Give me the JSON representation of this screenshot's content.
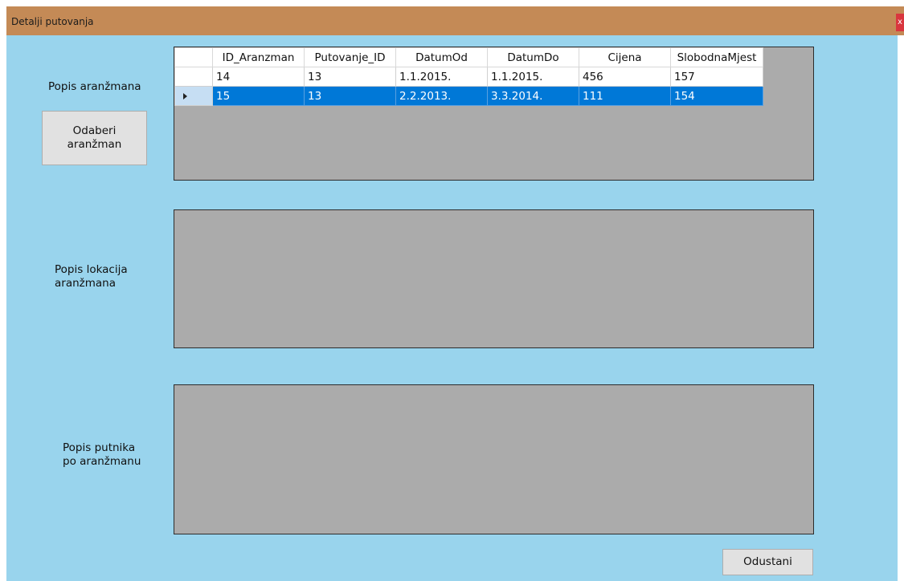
{
  "window": {
    "title": "Detalji putovanja",
    "close_glyph": "x"
  },
  "labels": {
    "arrangements": "Popis aranžmana",
    "locations": "Popis lokacija\naranžmana",
    "passengers": "Popis putnika\npo aranžmanu"
  },
  "buttons": {
    "select_arrangement": "Odaberi\naranžman",
    "cancel": "Odustani"
  },
  "arrangements_grid": {
    "columns": [
      "ID_Aranzman",
      "Putovanje_ID",
      "DatumOd",
      "DatumDo",
      "Cijena",
      "SlobodnaMjest"
    ],
    "rows": [
      {
        "cells": [
          "14",
          "13",
          "1.1.2015.",
          "1.1.2015.",
          "456",
          "157"
        ],
        "selected": false
      },
      {
        "cells": [
          "15",
          "13",
          "2.2.2013.",
          "3.3.2014.",
          "111",
          "154"
        ],
        "selected": true
      }
    ],
    "row_indicator_icon": "current-row-arrow-icon"
  },
  "colors": {
    "title_bar": "#c48a56",
    "form_background": "#99d4ed",
    "grid_background": "#ababab",
    "selection": "#0078d7",
    "close_button": "#d9363e"
  }
}
